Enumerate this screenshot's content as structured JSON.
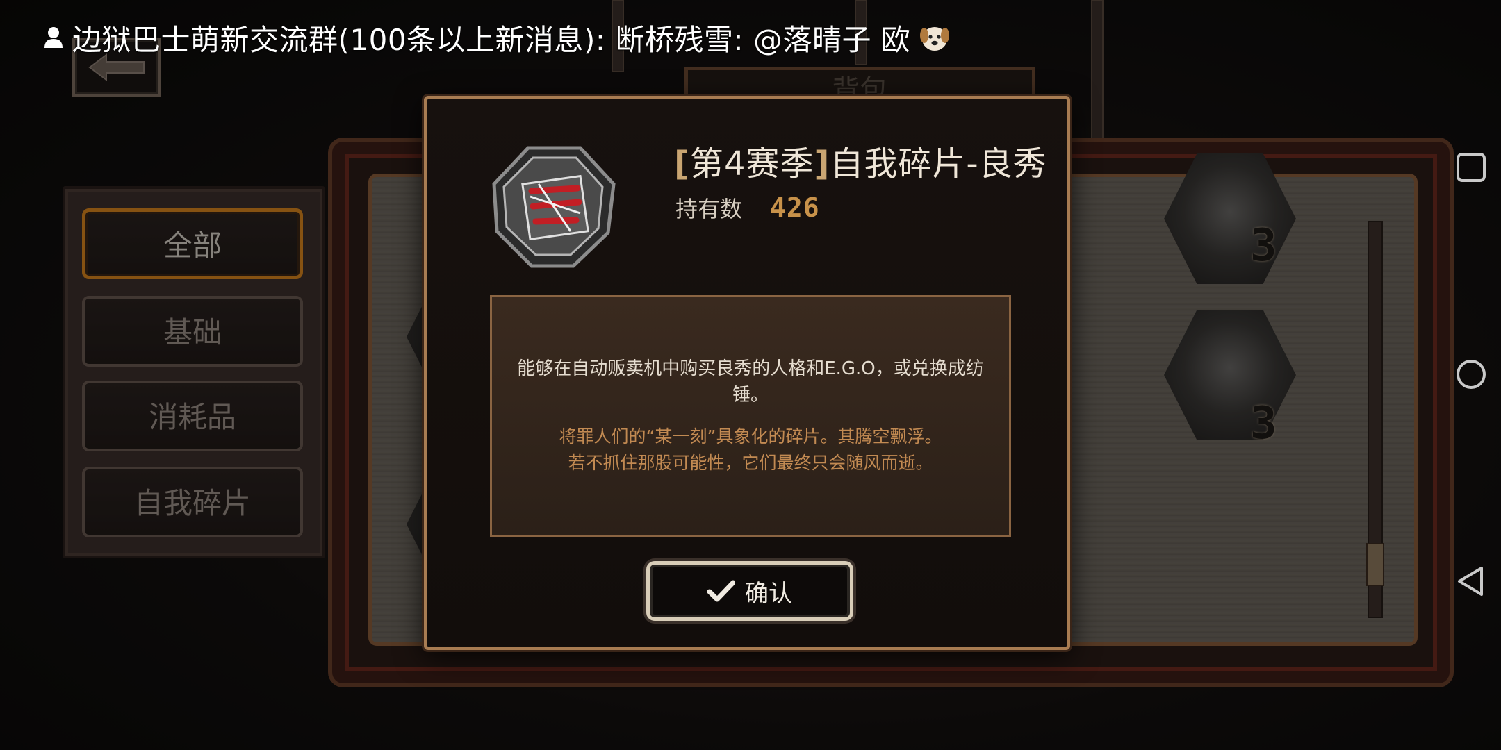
{
  "notification": {
    "text": "边狱巴士萌新交流群(100条以上新消息): 断桥残雪: @落晴子 欧"
  },
  "background": {
    "tab_label": "背包",
    "item_counts": [
      "3",
      "3"
    ]
  },
  "sidebar": {
    "items": [
      {
        "label": "全部",
        "active": true
      },
      {
        "label": "基础",
        "active": false
      },
      {
        "label": "消耗品",
        "active": false
      },
      {
        "label": "自我碎片",
        "active": false
      }
    ]
  },
  "popup": {
    "title_bracket_open": "[",
    "title_season": "第4赛季",
    "title_bracket_close": "]",
    "title_name": "自我碎片-良秀",
    "held_label": "持有数",
    "held_count": "426",
    "description_main": "能够在自动贩卖机中购买良秀的人格和E.G.O，或兑换成纺锤。",
    "description_flavor_line1": "将罪人们的“某一刻”具象化的碎片。其腾空飘浮。",
    "description_flavor_line2": "若不抓住那股可能性，它们最终只会随风而逝。",
    "confirm_label": "确认"
  },
  "colors": {
    "accent_orange": "#d9851e",
    "count_gold": "#c8924a",
    "flavor_text": "#c28a52",
    "popup_border": "#a87c52"
  },
  "icons": [
    "user-icon",
    "dog-emoji-icon",
    "back-arrow-icon",
    "checkmark-icon",
    "recent-apps-icon",
    "home-icon",
    "back-nav-icon"
  ]
}
